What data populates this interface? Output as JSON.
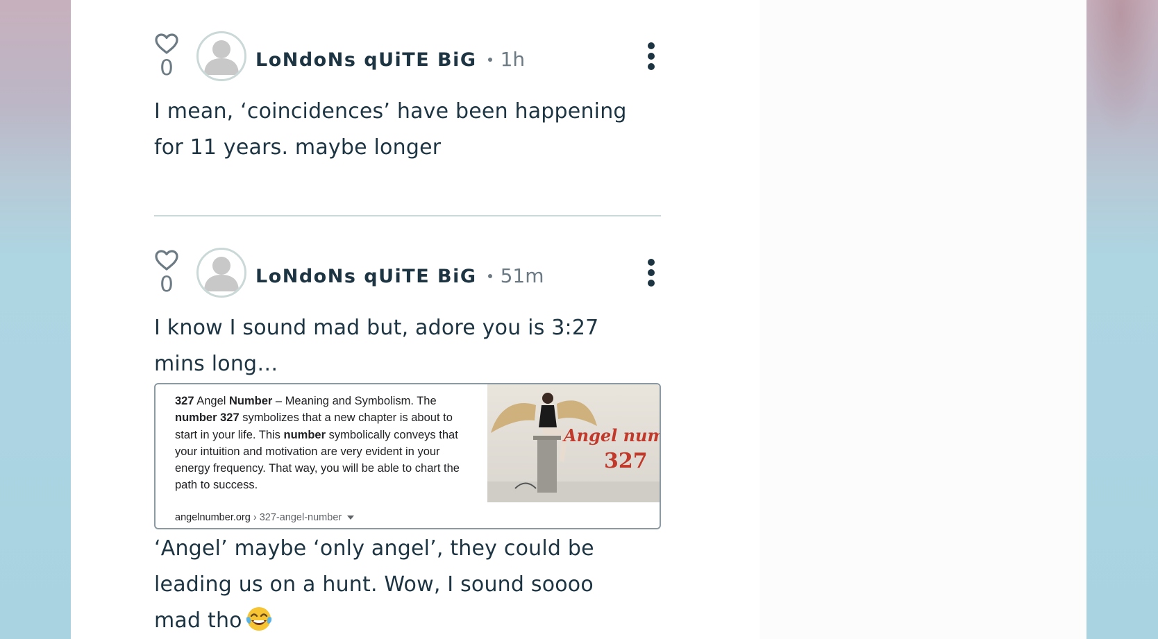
{
  "colors": {
    "text": "#1d3442",
    "muted": "#6c7a84",
    "divider": "#c9d8d8",
    "panel": "#ffffff",
    "page_background": "#a9d3e1"
  },
  "posts": [
    {
      "like_count": "0",
      "like_icon": "heart-outline-icon",
      "avatar_icon": "default-user-avatar",
      "author": "LoNdoNs qUiTE BiG",
      "time": "1h",
      "more_icon": "vertical-ellipsis-icon",
      "body": "I mean, ‘coincidences’ have been happening for 11 years. maybe  longer"
    },
    {
      "like_count": "0",
      "like_icon": "heart-outline-icon",
      "avatar_icon": "default-user-avatar",
      "author": "LoNdoNs qUiTE BiG",
      "time": "51m",
      "more_icon": "vertical-ellipsis-icon",
      "body_before": "I know I sound mad but, adore you is 3:27 mins long…",
      "embed": {
        "n1": "327",
        "t1": " Angel ",
        "b1": "Number",
        "t2": " – Meaning and Symbolism. The ",
        "b2": "number 327",
        "t3": " symbolizes that a new chapter is about to start in your life. This ",
        "b3": "number",
        "t4": " symbolically conveys that your intuition and motivation are very evident in your energy frequency. That way, you will be able to chart the path to success.",
        "url_domain": "angelnumber.org",
        "url_path": " › 327-angel-number",
        "image_caption_line1": "Angel numl",
        "image_caption_line2": "327"
      },
      "body_after": "‘Angel’ maybe ‘only angel’, they could be leading us on a hunt. Wow, I sound soooo mad tho",
      "emoji": "face-with-tears-of-joy"
    }
  ]
}
